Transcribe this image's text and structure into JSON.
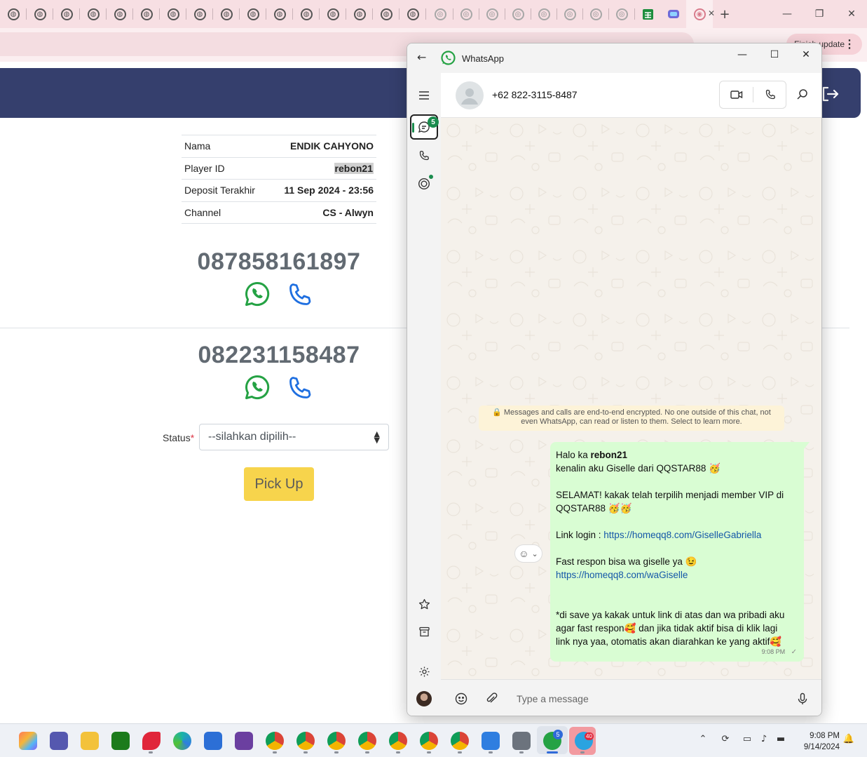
{
  "browser": {
    "finish_update_label": "Finish update",
    "menu_label": "⋮"
  },
  "page": {
    "info": {
      "rows": [
        {
          "label": "Nama",
          "value": "ENDIK CAHYONO"
        },
        {
          "label": "Player ID",
          "value": "rebon21"
        },
        {
          "label": "Deposit Terakhir",
          "value": "11 Sep 2024 - 23:56"
        },
        {
          "label": "Channel",
          "value": "CS - Alwyn"
        }
      ]
    },
    "phones": [
      "087858161897",
      "082231158487"
    ],
    "status_label": "Status",
    "status_required_mark": "*",
    "status_value": "--silahkan dipilih--",
    "pickup_label": "Pick Up"
  },
  "whatsapp": {
    "app_title": "WhatsApp",
    "unread_badge": "5",
    "contact": "+62 822-3115-8487",
    "encryption_notice": "🔒 Messages and calls are end-to-end encrypted. No one outside of this chat, not even WhatsApp, can read or listen to them. Select to learn more.",
    "message": {
      "greeting_prefix": "Halo ka ",
      "greeting_name": "rebon21",
      "line2": "kenalin aku Giselle dari QQSTAR88 🥳",
      "line3a": "SELAMAT! kakak telah terpilih menjadi member VIP di",
      "line3b": "QQSTAR88 🥳🥳",
      "login_prefix": "Link login : ",
      "login_link": "https://homeqq8.com/GiselleGabriella",
      "fast_line": "Fast respon bisa wa giselle ya 😉",
      "wa_link": "https://homeqq8.com/waGiselle",
      "note1": "*di save ya kakak untuk link di atas dan wa pribadi aku",
      "note2": "agar fast respon🥰 dan jika tidak aktif bisa di klik lagi",
      "note3": "link nya yaa, otomatis akan diarahkan ke yang aktif🥰",
      "time": "9:08 PM",
      "tick": "✓"
    },
    "input_placeholder": "Type a message"
  },
  "taskbar": {
    "time": "9:08 PM",
    "date": "9/14/2024",
    "whatsapp_badge": "5",
    "telegram_badge": "40"
  }
}
